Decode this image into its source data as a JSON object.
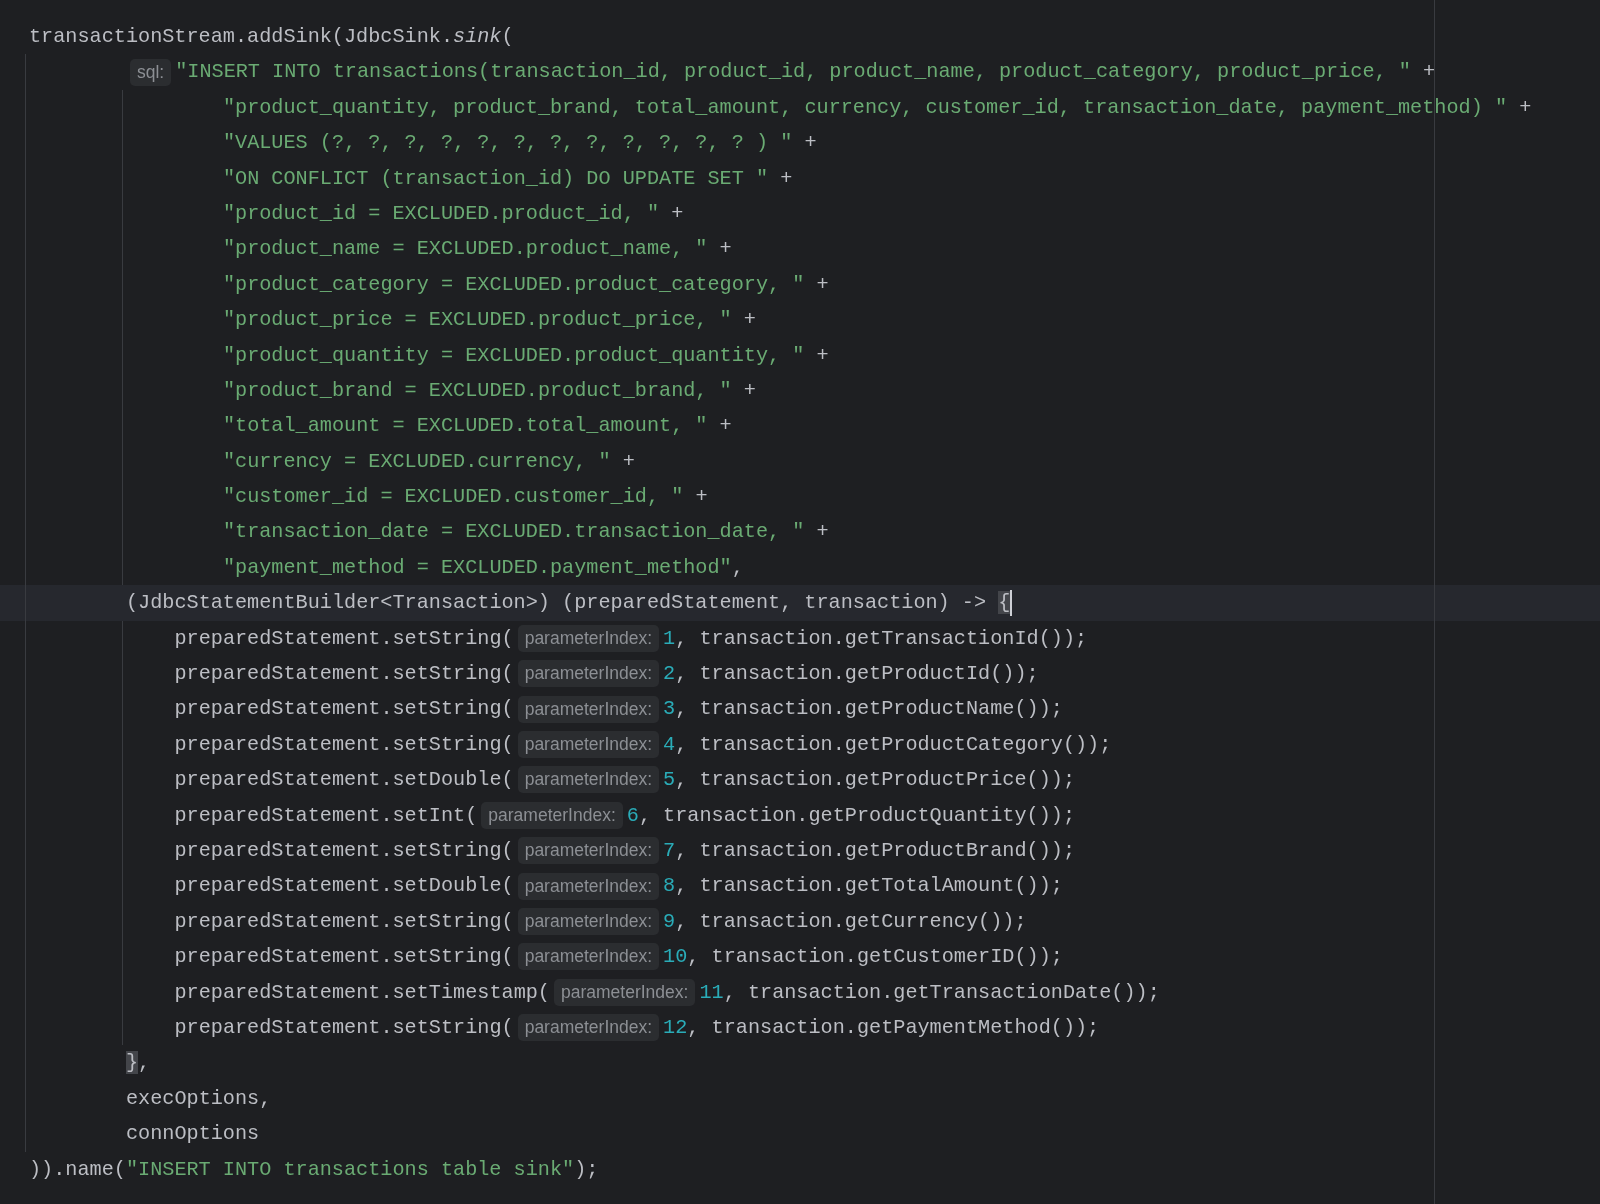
{
  "editor": {
    "lines": [
      {
        "kind": "continuation",
        "tokens": [
          {
            "kind": "plain",
            "text": "transactionStream.addSink(JdbcSink."
          },
          {
            "kind": "static_call",
            "text": "sink"
          },
          {
            "kind": "plain",
            "text": "("
          }
        ],
        "children": [
          {
            "kind": "continuation",
            "tokens": [
              {
                "kind": "hint",
                "text": "sql:"
              },
              {
                "kind": "string",
                "text": "\"INSERT INTO transactions(transaction_id, product_id, product_name, product_category, product_price, \""
              },
              {
                "kind": "plain",
                "text": " +"
              }
            ],
            "children": [
              {
                "tokens": [
                  {
                    "kind": "string",
                    "text": "\"product_quantity, product_brand, total_amount, currency, customer_id, transaction_date, payment_method) \""
                  },
                  {
                    "kind": "plain",
                    "text": " +"
                  }
                ]
              },
              {
                "tokens": [
                  {
                    "kind": "string",
                    "text": "\"VALUES (?, ?, ?, ?, ?, ?, ?, ?, ?, ?, ?, ? ) \""
                  },
                  {
                    "kind": "plain",
                    "text": " +"
                  }
                ]
              },
              {
                "tokens": [
                  {
                    "kind": "string",
                    "text": "\"ON CONFLICT (transaction_id) DO UPDATE SET \""
                  },
                  {
                    "kind": "plain",
                    "text": " +"
                  }
                ]
              },
              {
                "tokens": [
                  {
                    "kind": "string",
                    "text": "\"product_id = EXCLUDED.product_id, \""
                  },
                  {
                    "kind": "plain",
                    "text": " +"
                  }
                ]
              },
              {
                "tokens": [
                  {
                    "kind": "string",
                    "text": "\"product_name = EXCLUDED.product_name, \""
                  },
                  {
                    "kind": "plain",
                    "text": " +"
                  }
                ]
              },
              {
                "tokens": [
                  {
                    "kind": "string",
                    "text": "\"product_category = EXCLUDED.product_category, \""
                  },
                  {
                    "kind": "plain",
                    "text": " +"
                  }
                ]
              },
              {
                "tokens": [
                  {
                    "kind": "string",
                    "text": "\"product_price = EXCLUDED.product_price, \""
                  },
                  {
                    "kind": "plain",
                    "text": " +"
                  }
                ]
              },
              {
                "tokens": [
                  {
                    "kind": "string",
                    "text": "\"product_quantity = EXCLUDED.product_quantity, \""
                  },
                  {
                    "kind": "plain",
                    "text": " +"
                  }
                ]
              },
              {
                "tokens": [
                  {
                    "kind": "string",
                    "text": "\"product_brand = EXCLUDED.product_brand, \""
                  },
                  {
                    "kind": "plain",
                    "text": " +"
                  }
                ]
              },
              {
                "tokens": [
                  {
                    "kind": "string",
                    "text": "\"total_amount = EXCLUDED.total_amount, \""
                  },
                  {
                    "kind": "plain",
                    "text": " +"
                  }
                ]
              },
              {
                "tokens": [
                  {
                    "kind": "string",
                    "text": "\"currency = EXCLUDED.currency, \""
                  },
                  {
                    "kind": "plain",
                    "text": " +"
                  }
                ]
              },
              {
                "tokens": [
                  {
                    "kind": "string",
                    "text": "\"customer_id = EXCLUDED.customer_id, \""
                  },
                  {
                    "kind": "plain",
                    "text": " +"
                  }
                ]
              },
              {
                "tokens": [
                  {
                    "kind": "string",
                    "text": "\"transaction_date = EXCLUDED.transaction_date, \""
                  },
                  {
                    "kind": "plain",
                    "text": " +"
                  }
                ]
              },
              {
                "tokens": [
                  {
                    "kind": "string",
                    "text": "\"payment_method = EXCLUDED.payment_method\""
                  },
                  {
                    "kind": "plain",
                    "text": ","
                  }
                ]
              }
            ]
          },
          {
            "kind": "block",
            "current": true,
            "caret": true,
            "tokens": [
              {
                "kind": "plain",
                "text": "(JdbcStatementBuilder<Transaction>) (preparedStatement, transaction) -> "
              },
              {
                "kind": "brace_match",
                "text": "{"
              }
            ],
            "children": [
              {
                "tokens": [
                  {
                    "kind": "plain",
                    "text": "preparedStatement.setString("
                  },
                  {
                    "kind": "hint",
                    "text": "parameterIndex:"
                  },
                  {
                    "kind": "number",
                    "text": "1"
                  },
                  {
                    "kind": "plain",
                    "text": ", transaction.getTransactionId());"
                  }
                ]
              },
              {
                "tokens": [
                  {
                    "kind": "plain",
                    "text": "preparedStatement.setString("
                  },
                  {
                    "kind": "hint",
                    "text": "parameterIndex:"
                  },
                  {
                    "kind": "number",
                    "text": "2"
                  },
                  {
                    "kind": "plain",
                    "text": ", transaction.getProductId());"
                  }
                ]
              },
              {
                "tokens": [
                  {
                    "kind": "plain",
                    "text": "preparedStatement.setString("
                  },
                  {
                    "kind": "hint",
                    "text": "parameterIndex:"
                  },
                  {
                    "kind": "number",
                    "text": "3"
                  },
                  {
                    "kind": "plain",
                    "text": ", transaction.getProductName());"
                  }
                ]
              },
              {
                "tokens": [
                  {
                    "kind": "plain",
                    "text": "preparedStatement.setString("
                  },
                  {
                    "kind": "hint",
                    "text": "parameterIndex:"
                  },
                  {
                    "kind": "number",
                    "text": "4"
                  },
                  {
                    "kind": "plain",
                    "text": ", transaction.getProductCategory());"
                  }
                ]
              },
              {
                "tokens": [
                  {
                    "kind": "plain",
                    "text": "preparedStatement.setDouble("
                  },
                  {
                    "kind": "hint",
                    "text": "parameterIndex:"
                  },
                  {
                    "kind": "number",
                    "text": "5"
                  },
                  {
                    "kind": "plain",
                    "text": ", transaction.getProductPrice());"
                  }
                ]
              },
              {
                "tokens": [
                  {
                    "kind": "plain",
                    "text": "preparedStatement.setInt("
                  },
                  {
                    "kind": "hint",
                    "text": "parameterIndex:"
                  },
                  {
                    "kind": "number",
                    "text": "6"
                  },
                  {
                    "kind": "plain",
                    "text": ", transaction.getProductQuantity());"
                  }
                ]
              },
              {
                "tokens": [
                  {
                    "kind": "plain",
                    "text": "preparedStatement.setString("
                  },
                  {
                    "kind": "hint",
                    "text": "parameterIndex:"
                  },
                  {
                    "kind": "number",
                    "text": "7"
                  },
                  {
                    "kind": "plain",
                    "text": ", transaction.getProductBrand());"
                  }
                ]
              },
              {
                "tokens": [
                  {
                    "kind": "plain",
                    "text": "preparedStatement.setDouble("
                  },
                  {
                    "kind": "hint",
                    "text": "parameterIndex:"
                  },
                  {
                    "kind": "number",
                    "text": "8"
                  },
                  {
                    "kind": "plain",
                    "text": ", transaction.getTotalAmount());"
                  }
                ]
              },
              {
                "tokens": [
                  {
                    "kind": "plain",
                    "text": "preparedStatement.setString("
                  },
                  {
                    "kind": "hint",
                    "text": "parameterIndex:"
                  },
                  {
                    "kind": "number",
                    "text": "9"
                  },
                  {
                    "kind": "plain",
                    "text": ", transaction.getCurrency());"
                  }
                ]
              },
              {
                "tokens": [
                  {
                    "kind": "plain",
                    "text": "preparedStatement.setString("
                  },
                  {
                    "kind": "hint",
                    "text": "parameterIndex:"
                  },
                  {
                    "kind": "number",
                    "text": "10"
                  },
                  {
                    "kind": "plain",
                    "text": ", transaction.getCustomerID());"
                  }
                ]
              },
              {
                "tokens": [
                  {
                    "kind": "plain",
                    "text": "preparedStatement.setTimestamp("
                  },
                  {
                    "kind": "hint",
                    "text": "parameterIndex:"
                  },
                  {
                    "kind": "number",
                    "text": "11"
                  },
                  {
                    "kind": "plain",
                    "text": ", transaction.getTransactionDate());"
                  }
                ]
              },
              {
                "tokens": [
                  {
                    "kind": "plain",
                    "text": "preparedStatement.setString("
                  },
                  {
                    "kind": "hint",
                    "text": "parameterIndex:"
                  },
                  {
                    "kind": "number",
                    "text": "12"
                  },
                  {
                    "kind": "plain",
                    "text": ", transaction.getPaymentMethod());"
                  }
                ]
              }
            ]
          },
          {
            "tokens": [
              {
                "kind": "brace_match",
                "text": "}"
              },
              {
                "kind": "plain",
                "text": ","
              }
            ]
          },
          {
            "tokens": [
              {
                "kind": "plain",
                "text": "execOptions,"
              }
            ]
          },
          {
            "tokens": [
              {
                "kind": "plain",
                "text": "connOptions"
              }
            ]
          }
        ]
      },
      {
        "tokens": [
          {
            "kind": "plain",
            "text": ")).name("
          },
          {
            "kind": "string",
            "text": "\"INSERT INTO transactions table sink\""
          },
          {
            "kind": "plain",
            "text": ");"
          }
        ]
      }
    ]
  }
}
